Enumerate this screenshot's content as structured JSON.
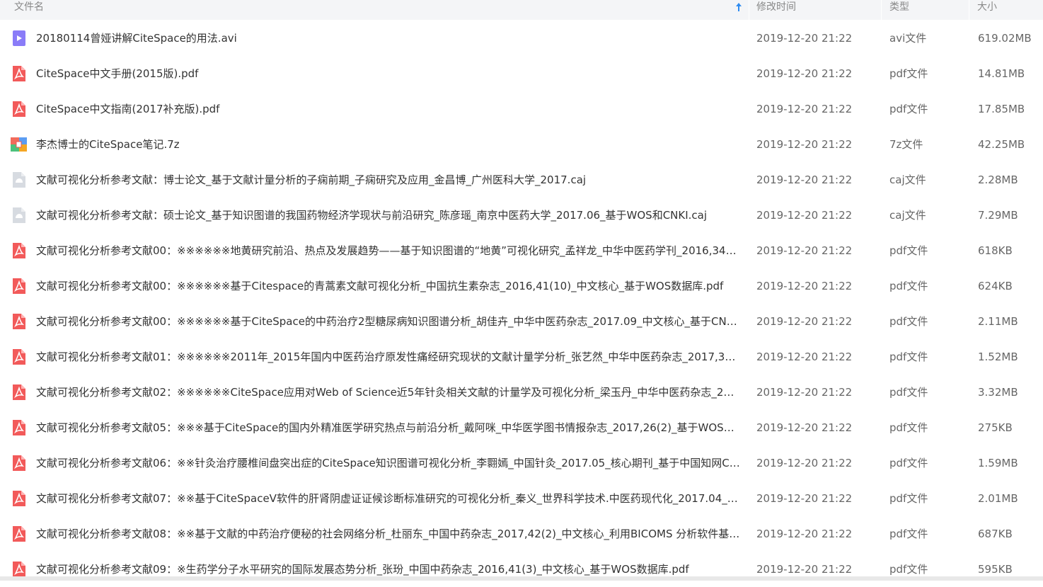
{
  "columns": {
    "name": "文件名",
    "modified": "修改时间",
    "type": "类型",
    "size": "大小"
  },
  "sort": {
    "column": "name",
    "direction": "ascending",
    "icon": "arrow-up-icon",
    "color": "#2f8cf0"
  },
  "icon_colors": {
    "pdf": "#f25a5a",
    "avi": "#8a7cf8",
    "caj": "#d7dbe1",
    "archive": "#f5a623"
  },
  "files": [
    {
      "name": "20180114曾娅讲解CiteSpace的用法.avi",
      "modified": "2019-12-20 21:22",
      "type": "avi文件",
      "size": "619.02MB",
      "icon": "video-file-icon"
    },
    {
      "name": "CiteSpace中文手册(2015版).pdf",
      "modified": "2019-12-20 21:22",
      "type": "pdf文件",
      "size": "14.81MB",
      "icon": "pdf-file-icon"
    },
    {
      "name": "CiteSpace中文指南(2017补充版).pdf",
      "modified": "2019-12-20 21:22",
      "type": "pdf文件",
      "size": "17.85MB",
      "icon": "pdf-file-icon"
    },
    {
      "name": "李杰博士的CiteSpace笔记.7z",
      "modified": "2019-12-20 21:22",
      "type": "7z文件",
      "size": "42.25MB",
      "icon": "archive-file-icon"
    },
    {
      "name": "文献可视化分析参考文献：博士论文_基于文献计量分析的子痫前期_子痫研究及应用_金昌博_广州医科大学_2017.caj",
      "modified": "2019-12-20 21:22",
      "type": "caj文件",
      "size": "2.28MB",
      "icon": "caj-file-icon"
    },
    {
      "name": "文献可视化分析参考文献：硕士论文_基于知识图谱的我国药物经济学现状与前沿研究_陈彦瑶_南京中医药大学_2017.06_基于WOS和CNKI.caj",
      "modified": "2019-12-20 21:22",
      "type": "caj文件",
      "size": "7.29MB",
      "icon": "caj-file-icon"
    },
    {
      "name": "文献可视化分析参考文献00：※※※※※※地黄研究前沿、热点及发展趋势——基于知识图谱的“地黄”可视化研究_孟祥龙_中华中医药学刊_2016,34(6...",
      "modified": "2019-12-20 21:22",
      "type": "pdf文件",
      "size": "618KB",
      "icon": "pdf-file-icon"
    },
    {
      "name": "文献可视化分析参考文献00：※※※※※※基于Citespace的青蒿素文献可视化分析_中国抗生素杂志_2016,41(10)_中文核心_基于WOS数据库.pdf",
      "modified": "2019-12-20 21:22",
      "type": "pdf文件",
      "size": "624KB",
      "icon": "pdf-file-icon"
    },
    {
      "name": "文献可视化分析参考文献00：※※※※※※基于CiteSpace的中药治疗2型糖尿病知识图谱分析_胡佳卉_中华中医药杂志_2017.09_中文核心_基于CNKI数...",
      "modified": "2019-12-20 21:22",
      "type": "pdf文件",
      "size": "2.11MB",
      "icon": "pdf-file-icon"
    },
    {
      "name": "文献可视化分析参考文献01：※※※※※※2011年_2015年国内中医药治疗原发性痛经研究现状的文献计量学分析_张艺然_中华中医药杂志_2017,32(6)_...",
      "modified": "2019-12-20 21:22",
      "type": "pdf文件",
      "size": "1.52MB",
      "icon": "pdf-file-icon"
    },
    {
      "name": "文献可视化分析参考文献02：※※※※※※CiteSpace应用对Web of Science近5年针灸相关文献的计量学及可视化分析_梁玉丹_中华中医药杂志_2017....",
      "modified": "2019-12-20 21:22",
      "type": "pdf文件",
      "size": "3.32MB",
      "icon": "pdf-file-icon"
    },
    {
      "name": "文献可视化分析参考文献05：※※※基于CiteSpace的国内外精准医学研究热点与前沿分析_戴阿咪_中华医学图书情报杂志_2017,26(2)_基于WOS和C...",
      "modified": "2019-12-20 21:22",
      "type": "pdf文件",
      "size": "275KB",
      "icon": "pdf-file-icon"
    },
    {
      "name": "文献可视化分析参考文献06：※※针灸治疗腰椎间盘突出症的CiteSpace知识图谱可视化分析_李翾嫣_中国针灸_2017.05_核心期刊_基于中国知网CN...",
      "modified": "2019-12-20 21:22",
      "type": "pdf文件",
      "size": "1.59MB",
      "icon": "pdf-file-icon"
    },
    {
      "name": "文献可视化分析参考文献07：※※基于CiteSpaceⅤ软件的肝肾阴虚证证候诊断标准研究的可视化分析_秦义_世界科学技术.中医药现代化_2017.04_中...",
      "modified": "2019-12-20 21:22",
      "type": "pdf文件",
      "size": "2.01MB",
      "icon": "pdf-file-icon"
    },
    {
      "name": "文献可视化分析参考文献08：※※基于文献的中药治疗便秘的社会网络分析_杜丽东_中国中药杂志_2017,42(2)_中文核心_利用BICOMS 分析软件基于...",
      "modified": "2019-12-20 21:22",
      "type": "pdf文件",
      "size": "687KB",
      "icon": "pdf-file-icon"
    },
    {
      "name": "文献可视化分析参考文献09：※生药学分子水平研究的国际发展态势分析_张玢_中国中药杂志_2016,41(3)_中文核心_基于WOS数据库.pdf",
      "modified": "2019-12-20 21:22",
      "type": "pdf文件",
      "size": "595KB",
      "icon": "pdf-file-icon"
    }
  ]
}
